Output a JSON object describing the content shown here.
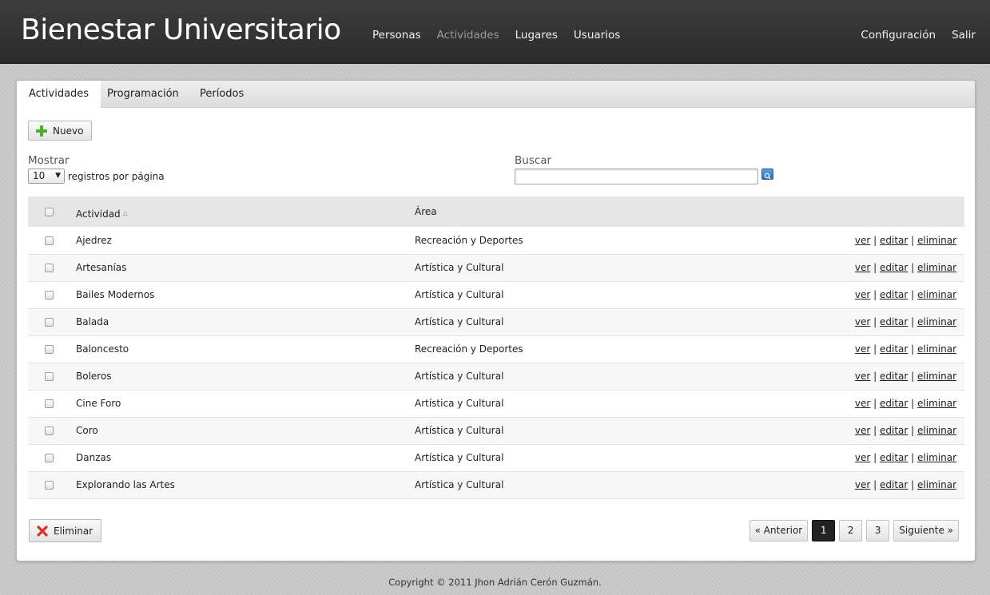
{
  "header": {
    "brand": "Bienestar Universitario",
    "nav": [
      {
        "label": "Personas",
        "active": false
      },
      {
        "label": "Actividades",
        "active": true
      },
      {
        "label": "Lugares",
        "active": false
      },
      {
        "label": "Usuarios",
        "active": false
      }
    ],
    "right_nav": {
      "settings": "Configuración",
      "logout": "Salir"
    }
  },
  "tabs": [
    {
      "label": "Actividades",
      "active": true
    },
    {
      "label": "Programación",
      "active": false
    },
    {
      "label": "Períodos",
      "active": false
    }
  ],
  "toolbar": {
    "new_label": "Nuevo",
    "new_icon": "plus-icon"
  },
  "filters": {
    "show_label": "Mostrar",
    "page_size": "10",
    "per_page_label": "registros por página",
    "search_label": "Buscar",
    "search_value": "",
    "search_icon": "search-icon"
  },
  "table": {
    "columns": [
      "Actividad",
      "Área"
    ],
    "sorted_column": "Actividad",
    "rows": [
      {
        "actividad": "Ajedrez",
        "area": "Recreación y Deportes"
      },
      {
        "actividad": "Artesanías",
        "area": "Artística y Cultural"
      },
      {
        "actividad": "Bailes Modernos",
        "area": "Artística y Cultural"
      },
      {
        "actividad": "Balada",
        "area": "Artística y Cultural"
      },
      {
        "actividad": "Baloncesto",
        "area": "Recreación y Deportes"
      },
      {
        "actividad": "Boleros",
        "area": "Artística y Cultural"
      },
      {
        "actividad": "Cine Foro",
        "area": "Artística y Cultural"
      },
      {
        "actividad": "Coro",
        "area": "Artística y Cultural"
      },
      {
        "actividad": "Danzas",
        "area": "Artística y Cultural"
      },
      {
        "actividad": "Explorando las Artes",
        "area": "Artística y Cultural"
      }
    ],
    "actions": {
      "view": "ver",
      "edit": "editar",
      "delete": "eliminar",
      "sep": "|"
    }
  },
  "bulk": {
    "delete_label": "Eliminar",
    "delete_icon": "x-icon"
  },
  "pager": {
    "prev": "« Anterior",
    "pages": [
      "1",
      "2",
      "3"
    ],
    "current": "1",
    "next": "Siguiente »"
  },
  "footer": {
    "copyright": "Copyright © 2011 Jhon Adrián Cerón Guzmán."
  },
  "colors": {
    "topbar": "#333333",
    "accent_search": "#3a83d4",
    "plus_green": "#4caf2a",
    "delete_red": "#d9302c"
  }
}
